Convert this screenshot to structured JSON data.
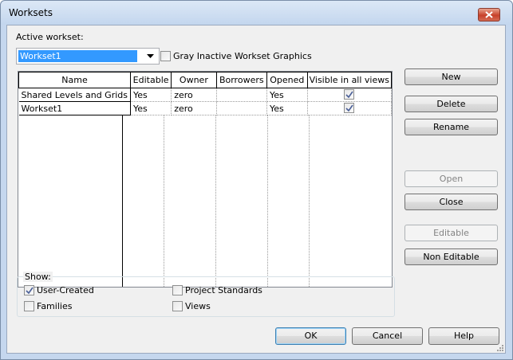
{
  "window": {
    "title": "Worksets"
  },
  "active_workset": {
    "label": "Active workset:",
    "selected": "Workset1",
    "gray_inactive_label": "Gray Inactive Workset Graphics",
    "gray_inactive_checked": false
  },
  "table": {
    "columns": [
      "Name",
      "Editable",
      "Owner",
      "Borrowers",
      "Opened",
      "Visible in all views"
    ],
    "rows": [
      {
        "name": "Shared Levels and Grids",
        "editable": "Yes",
        "owner": "zero",
        "borrowers": "",
        "opened": "Yes",
        "visible": true
      },
      {
        "name": "Workset1",
        "editable": "Yes",
        "owner": "zero",
        "borrowers": "",
        "opened": "Yes",
        "visible": true
      }
    ]
  },
  "side_buttons": {
    "new": "New",
    "delete": "Delete",
    "rename": "Rename",
    "open": "Open",
    "close": "Close",
    "editable": "Editable",
    "non_editable": "Non Editable"
  },
  "show": {
    "label": "Show:",
    "user_created": {
      "label": "User-Created",
      "checked": true
    },
    "families": {
      "label": "Families",
      "checked": false
    },
    "project_standards": {
      "label": "Project Standards",
      "checked": false
    },
    "views": {
      "label": "Views",
      "checked": false
    }
  },
  "footer": {
    "ok": "OK",
    "cancel": "Cancel",
    "help": "Help"
  },
  "colors": {
    "selection": "#3399ff",
    "close_button": "#c8412a"
  }
}
